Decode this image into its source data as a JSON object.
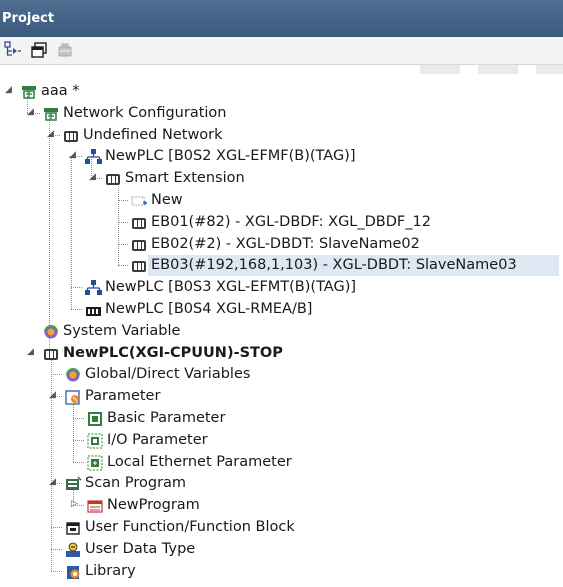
{
  "panel": {
    "title": "Project"
  },
  "toolbar": {
    "buttons": [
      {
        "name": "tree-view-icon"
      },
      {
        "name": "copy-window-icon"
      },
      {
        "name": "delete-icon",
        "disabled": true
      }
    ]
  },
  "tree": [
    {
      "name": "tree-item-aaa",
      "label": "aaa *",
      "icon": "project-icon",
      "expanded": true
    },
    {
      "name": "tree-item-network-configuration",
      "label": "Network Configuration",
      "icon": "network-config-icon",
      "expanded": true
    },
    {
      "name": "tree-item-undefined-network",
      "label": "Undefined Network",
      "icon": "network-icon",
      "expanded": true
    },
    {
      "name": "tree-item-newplc-b0s2",
      "label": "NewPLC [B0S2 XGL-EFMF(B)(TAG)]",
      "icon": "plc-network-icon",
      "expanded": true
    },
    {
      "name": "tree-item-smart-extension",
      "label": "Smart Extension",
      "icon": "module-icon",
      "expanded": true
    },
    {
      "name": "tree-item-new",
      "label": "New",
      "icon": "new-item-icon"
    },
    {
      "name": "tree-item-eb01",
      "label": "EB01(#82) - XGL-DBDF: XGL_DBDF_12",
      "icon": "module-icon"
    },
    {
      "name": "tree-item-eb02",
      "label": "EB02(#2) - XGL-DBDT: SlaveName02",
      "icon": "module-icon"
    },
    {
      "name": "tree-item-eb03",
      "label": "EB03(#192,168,1,103) - XGL-DBDT: SlaveName03",
      "icon": "module-icon",
      "selected": true
    },
    {
      "name": "tree-item-newplc-b0s3",
      "label": "NewPLC [B0S3 XGL-EFMT(B)(TAG)]",
      "icon": "plc-network-icon"
    },
    {
      "name": "tree-item-newplc-b0s4",
      "label": "NewPLC [B0S4 XGL-RMEA/B]",
      "icon": "rapi-module-icon"
    },
    {
      "name": "tree-item-system-variable",
      "label": "System Variable",
      "icon": "variable-icon"
    },
    {
      "name": "tree-item-newplc-xgi",
      "label": "NewPLC(XGI-CPUUN)-STOP",
      "icon": "cpu-icon",
      "expanded": true,
      "bold": true
    },
    {
      "name": "tree-item-global-direct-variables",
      "label": "Global/Direct Variables",
      "icon": "variable-icon"
    },
    {
      "name": "tree-item-parameter",
      "label": "Parameter",
      "icon": "parameter-icon",
      "expanded": true
    },
    {
      "name": "tree-item-basic-parameter",
      "label": "Basic Parameter",
      "icon": "basic-parameter-icon"
    },
    {
      "name": "tree-item-io-parameter",
      "label": "I/O Parameter",
      "icon": "io-parameter-icon"
    },
    {
      "name": "tree-item-local-ethernet-parameter",
      "label": "Local Ethernet Parameter",
      "icon": "ethernet-parameter-icon"
    },
    {
      "name": "tree-item-scan-program",
      "label": "Scan Program",
      "icon": "scan-program-icon",
      "expanded": true
    },
    {
      "name": "tree-item-newprogram",
      "label": "NewProgram",
      "icon": "program-icon",
      "expandable": true
    },
    {
      "name": "tree-item-user-function-block",
      "label": "User Function/Function Block",
      "icon": "function-block-icon"
    },
    {
      "name": "tree-item-user-data-type",
      "label": "User Data Type",
      "icon": "data-type-icon"
    },
    {
      "name": "tree-item-library",
      "label": "Library",
      "icon": "library-icon"
    }
  ],
  "colors": {
    "titlebar": "#3f5f84",
    "selection": "#dde8f3",
    "tree_lines": "#909090"
  }
}
